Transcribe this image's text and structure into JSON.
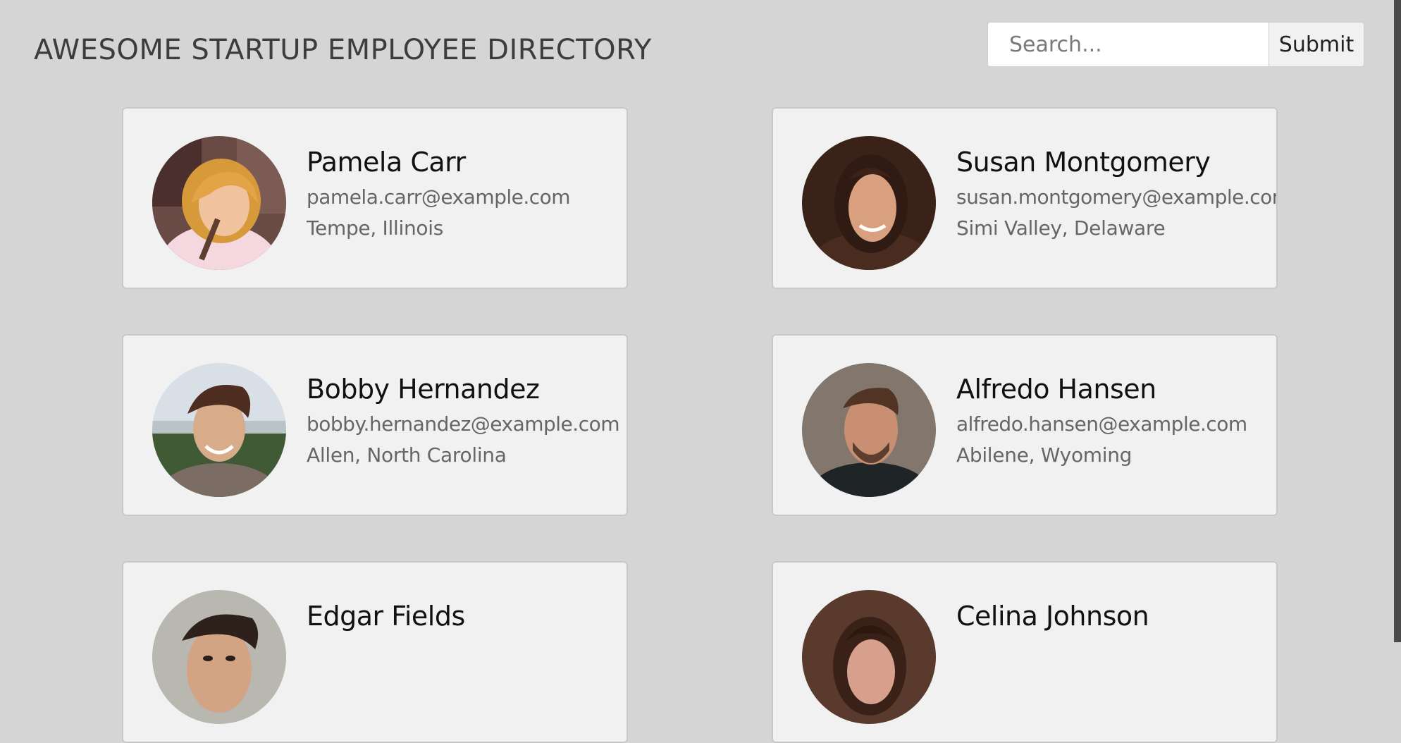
{
  "header": {
    "title": "AWESOME STARTUP EMPLOYEE DIRECTORY",
    "search_placeholder": "Search...",
    "search_value": "",
    "submit_label": "Submit"
  },
  "employees": [
    {
      "name": "Pamela Carr",
      "email": "pamela.carr@example.com",
      "location": "Tempe, Illinois"
    },
    {
      "name": "Susan Montgomery",
      "email": "susan.montgomery@example.com",
      "location": "Simi Valley, Delaware"
    },
    {
      "name": "Bobby Hernandez",
      "email": "bobby.hernandez@example.com",
      "location": "Allen, North Carolina"
    },
    {
      "name": "Alfredo Hansen",
      "email": "alfredo.hansen@example.com",
      "location": "Abilene, Wyoming"
    },
    {
      "name": "Edgar Fields",
      "email": "",
      "location": ""
    },
    {
      "name": "Celina Johnson",
      "email": "",
      "location": ""
    }
  ]
}
